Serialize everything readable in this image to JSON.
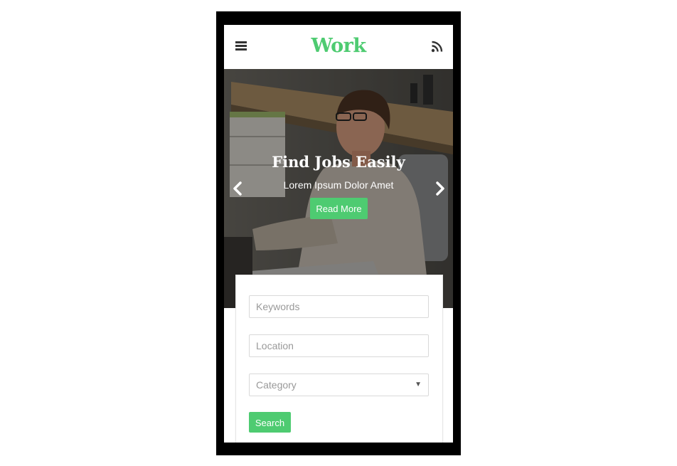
{
  "header": {
    "logo": "Work"
  },
  "hero": {
    "title": "Find Jobs Easily",
    "subtitle": "Lorem Ipsum Dolor Amet",
    "button_label": "Read More"
  },
  "search": {
    "keywords_placeholder": "Keywords",
    "location_placeholder": "Location",
    "category_placeholder": "Category",
    "button_label": "Search"
  },
  "icons": {
    "menu": "hamburger-menu-icon",
    "feed": "rss-icon",
    "prev": "chevron-left-icon",
    "next": "chevron-right-icon",
    "select": "caret-down-icon"
  },
  "colors": {
    "accent": "#4ecb71",
    "frame": "#000000",
    "text_dark": "#333333",
    "placeholder": "#999999"
  }
}
